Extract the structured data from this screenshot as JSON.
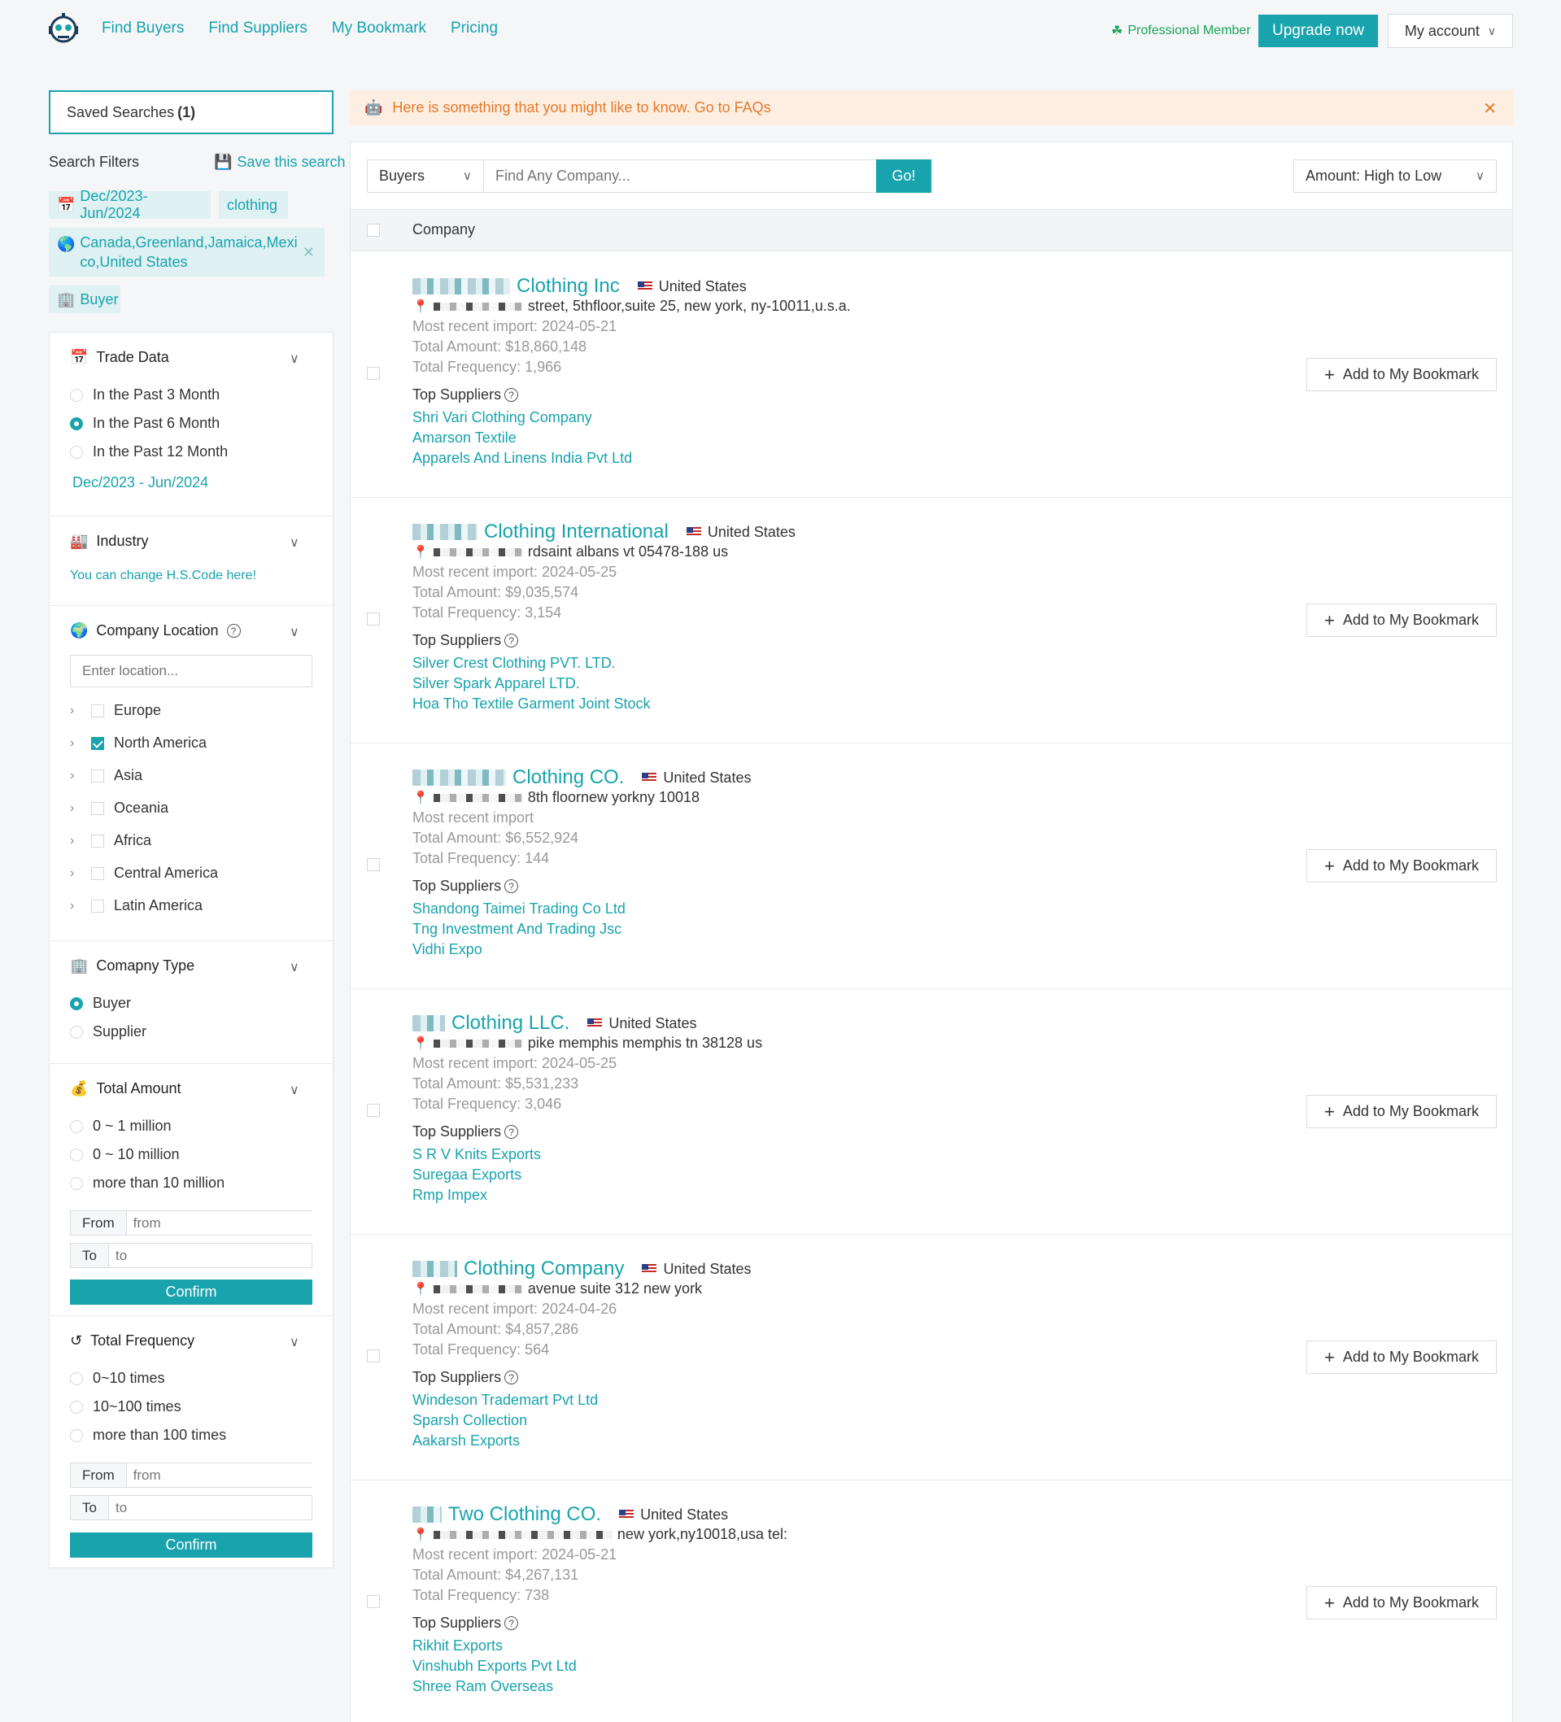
{
  "nav": {
    "links": [
      "Find Buyers",
      "Find Suppliers",
      "My Bookmark",
      "Pricing"
    ],
    "membership": "Professional Member",
    "upgrade_label": "Upgrade now",
    "account_label": "My account"
  },
  "sidebar": {
    "saved_searches_label": "Saved Searches",
    "saved_searches_count": "(1)",
    "search_filters_title": "Search Filters",
    "save_search_label": "Save this search",
    "tags": {
      "date": "Dec/2023-Jun/2024",
      "keyword": "clothing",
      "location": "Canada,Greenland,Jamaica,Mexico,United States",
      "type": "Buyer"
    },
    "trade_data": {
      "title": "Trade Data",
      "options": [
        "In the Past 3 Month",
        "In the Past 6 Month",
        "In the Past 12 Month"
      ],
      "selected": "In the Past 6 Month",
      "range_text": "Dec/2023 - Jun/2024"
    },
    "industry": {
      "title": "Industry",
      "hint": "You can change H.S.Code here!"
    },
    "company_location": {
      "title": "Company Location",
      "placeholder": "Enter location...",
      "regions": [
        "Europe",
        "North America",
        "Asia",
        "Oceania",
        "Africa",
        "Central America",
        "Latin America"
      ],
      "checked": "North America"
    },
    "company_type": {
      "title": "Comapny Type",
      "options": [
        "Buyer",
        "Supplier"
      ],
      "selected": "Buyer"
    },
    "total_amount": {
      "title": "Total Amount",
      "options": [
        "0 ~ 1 million",
        "0 ~ 10 million",
        "more than 10 million"
      ],
      "from_label": "From",
      "from_placeholder": "from",
      "to_label": "To",
      "to_placeholder": "to",
      "confirm_label": "Confirm"
    },
    "total_frequency": {
      "title": "Total Frequency",
      "options": [
        "0~10 times",
        "10~100 times",
        "more than 100 times"
      ],
      "from_label": "From",
      "from_placeholder": "from",
      "to_label": "To",
      "to_placeholder": "to",
      "confirm_label": "Confirm"
    }
  },
  "notice": "Here is something that you might like to know. Go to FAQs",
  "toolbar": {
    "type_select": "Buyers",
    "search_placeholder": "Find Any Company...",
    "go_label": "Go!",
    "sort_select": "Amount: High to Low"
  },
  "table": {
    "header": "Company",
    "top_suppliers_label": "Top Suppliers",
    "bookmark_label": "Add to My Bookmark",
    "rows": [
      {
        "name": "Clothing Inc",
        "country": "United States",
        "address": "street, 5thfloor,suite 25, new york, ny-10011,u.s.a.",
        "recent": "Most recent import: 2024-05-21",
        "amount": "Total Amount: $18,860,148",
        "frequency": "Total Frequency: 1,966",
        "suppliers": [
          "Shri Vari Clothing Company",
          "Amarson Textile",
          "Apparels And Linens India Pvt Ltd"
        ]
      },
      {
        "name": "Clothing International",
        "country": "United States",
        "address": "rdsaint albans vt 05478-188 us",
        "recent": "Most recent import: 2024-05-25",
        "amount": "Total Amount: $9,035,574",
        "frequency": "Total Frequency: 3,154",
        "suppliers": [
          "Silver Crest Clothing PVT. LTD.",
          "Silver Spark Apparel LTD.",
          "Hoa Tho Textile Garment Joint Stock"
        ]
      },
      {
        "name": "Clothing CO.",
        "country": "United States",
        "address": "8th floornew yorkny 10018",
        "recent": "Most recent import",
        "amount": "Total Amount: $6,552,924",
        "frequency": "Total Frequency: 144",
        "suppliers": [
          "Shandong Taimei Trading Co Ltd",
          "Tng Investment And Trading Jsc",
          "Vidhi Expo"
        ]
      },
      {
        "name": "Clothing LLC.",
        "country": "United States",
        "address": "pike memphis memphis tn 38128 us",
        "recent": "Most recent import: 2024-05-25",
        "amount": "Total Amount: $5,531,233",
        "frequency": "Total Frequency: 3,046",
        "suppliers": [
          "S R V Knits Exports",
          "Suregaa Exports",
          "Rmp Impex"
        ]
      },
      {
        "name": "Clothing Company",
        "country": "United States",
        "address": "avenue suite 312 new york",
        "recent": "Most recent import: 2024-04-26",
        "amount": "Total Amount: $4,857,286",
        "frequency": "Total Frequency: 564",
        "suppliers": [
          "Windeson Trademart Pvt Ltd",
          "Sparsh Collection",
          "Aakarsh Exports"
        ]
      },
      {
        "name": "Two Clothing CO.",
        "country": "United States",
        "address": "new york,ny10018,usa tel:",
        "recent": "Most recent import: 2024-05-21",
        "amount": "Total Amount: $4,267,131",
        "frequency": "Total Frequency: 738",
        "suppliers": [
          "Rikhit Exports",
          "Vinshubh Exports Pvt Ltd",
          "Shree Ram Overseas"
        ]
      }
    ]
  }
}
